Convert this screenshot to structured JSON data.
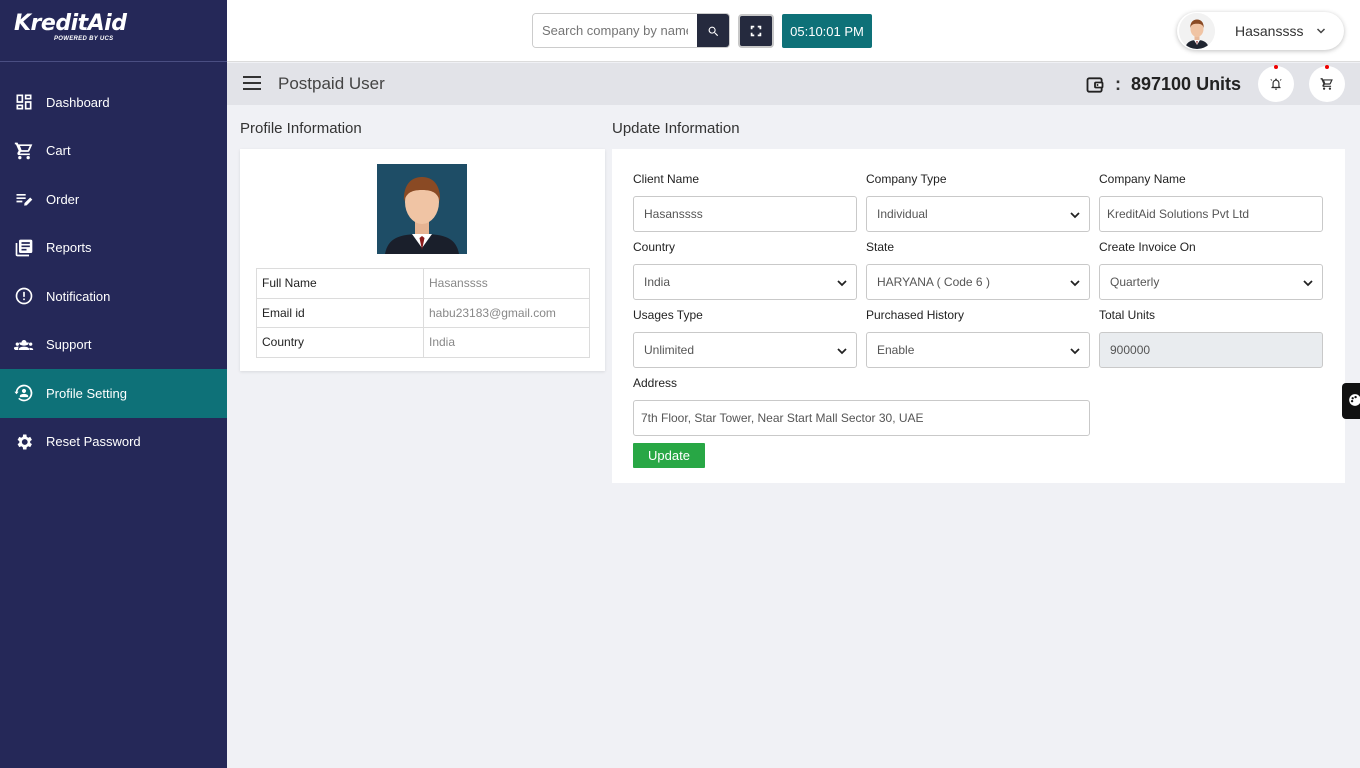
{
  "brand": {
    "name": "KreditAid",
    "tagline": "POWERED BY UCS"
  },
  "sidebar": {
    "items": [
      {
        "label": "Dashboard",
        "icon": "dashboard-icon"
      },
      {
        "label": "Cart",
        "icon": "cart-icon"
      },
      {
        "label": "Order",
        "icon": "order-icon"
      },
      {
        "label": "Reports",
        "icon": "reports-icon"
      },
      {
        "label": "Notification",
        "icon": "notification-icon"
      },
      {
        "label": "Support",
        "icon": "support-icon"
      },
      {
        "label": "Profile Setting",
        "icon": "profile-setting-icon",
        "active": true
      },
      {
        "label": "Reset Password",
        "icon": "gear-icon"
      }
    ]
  },
  "topbar": {
    "search_placeholder": "Search company by name",
    "time": "05:10:01 PM",
    "user_name": "Hasanssss"
  },
  "subheader": {
    "page_title": "Postpaid User",
    "wallet_separator": ":",
    "units": "897100 Units"
  },
  "profile": {
    "title": "Profile Information",
    "rows": [
      {
        "key": "Full Name",
        "value": "Hasanssss"
      },
      {
        "key": "Email id",
        "value": "habu23183@gmail.com"
      },
      {
        "key": "Country",
        "value": "India"
      }
    ]
  },
  "update": {
    "title": "Update Information",
    "client_name": {
      "label": "Client Name",
      "value": "Hasanssss"
    },
    "company_type": {
      "label": "Company Type",
      "value": "Individual"
    },
    "company_name": {
      "label": "Company Name",
      "value": "KreditAid Solutions Pvt Ltd"
    },
    "country": {
      "label": "Country",
      "value": "India"
    },
    "state": {
      "label": "State",
      "value": "HARYANA ( Code 6 )"
    },
    "invoice": {
      "label": "Create Invoice On",
      "value": "Quarterly"
    },
    "usage": {
      "label": "Usages Type",
      "value": "Unlimited"
    },
    "history": {
      "label": "Purchased History",
      "value": "Enable"
    },
    "total_units": {
      "label": "Total Units",
      "value": "900000"
    },
    "address": {
      "label": "Address",
      "value": "7th Floor, Star Tower, Near Start Mall Sector 30, UAE"
    },
    "button": "Update"
  },
  "colors": {
    "sidebar": "#252858",
    "accent": "#0e7178",
    "success": "#28a745",
    "dark": "#252a3e"
  }
}
